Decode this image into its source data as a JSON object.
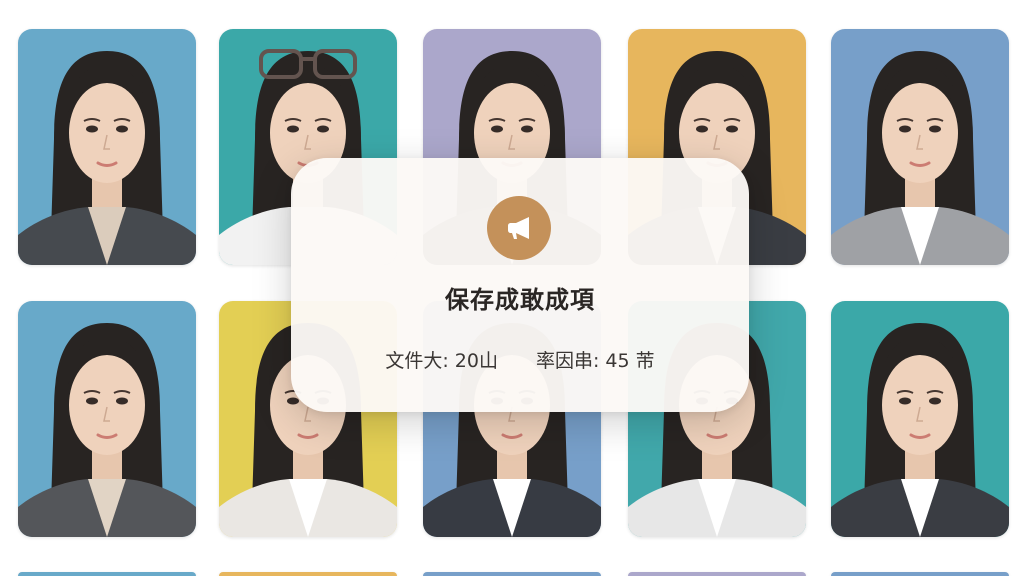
{
  "photos": [
    {
      "bg": "#5fa4c6",
      "outfit": "#3b3f45",
      "shirt": "#d9c9b8",
      "glasses": false
    },
    {
      "bg": "#2fa3a3",
      "outfit": "#f2f2f2",
      "shirt": "#f2f2f2",
      "glasses": true
    },
    {
      "bg": "#a6a2c8",
      "outfit": "#2b2f38",
      "shirt": "#ffffff",
      "glasses": false
    },
    {
      "bg": "#e6b253",
      "outfit": "#2e3138",
      "shirt": "#ffffff",
      "glasses": false
    },
    {
      "bg": "#6f9ac6",
      "outfit": "#9a9ca0",
      "shirt": "#ffffff",
      "glasses": false
    },
    {
      "bg": "#5fa4c6",
      "outfit": "#4a4c50",
      "shirt": "#e0d2c2",
      "glasses": false
    },
    {
      "bg": "#e2cc4a",
      "outfit": "#e9e6e2",
      "shirt": "#ffffff",
      "glasses": false
    },
    {
      "bg": "#6f9ac6",
      "outfit": "#2b2f38",
      "shirt": "#ffffff",
      "glasses": false
    },
    {
      "bg": "#36a3a6",
      "outfit": "#e6e6e6",
      "shirt": "#ffffff",
      "glasses": false
    },
    {
      "bg": "#2fa3a3",
      "outfit": "#2e3138",
      "shirt": "#ffffff",
      "glasses": false
    }
  ],
  "bottom_strip": [
    "#5fa4c6",
    "#e6b253",
    "#6f9ac6",
    "#a6a2c8",
    "#6f9ac6"
  ],
  "toast": {
    "icon": "megaphone-icon",
    "icon_bg": "#c4915a",
    "title": "保存成敢成項",
    "file_size": "文件大: 20山",
    "ratio": "率因串: 45 芾"
  }
}
